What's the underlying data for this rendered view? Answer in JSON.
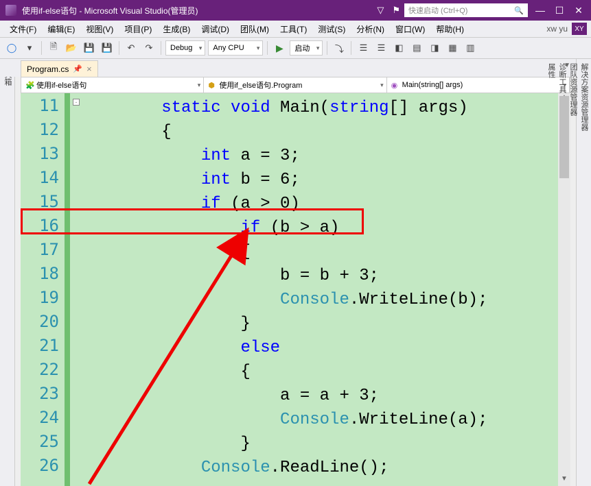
{
  "title": "使用if-else语句 - Microsoft Visual Studio(管理员)",
  "search": {
    "placeholder": "快速启动 (Ctrl+Q)"
  },
  "win": {
    "min": "—",
    "max": "☐",
    "close": "✕"
  },
  "menu": {
    "file": "文件(F)",
    "edit": "编辑(E)",
    "view": "视图(V)",
    "project": "项目(P)",
    "build": "生成(B)",
    "debug": "调试(D)",
    "team": "团队(M)",
    "tools": "工具(T)",
    "test": "测试(S)",
    "analyze": "分析(N)",
    "window": "窗口(W)",
    "help": "帮助(H)",
    "user": "xw yu",
    "xy": "XY"
  },
  "toolbar": {
    "config": "Debug",
    "platform": "Any CPU",
    "run": "启动"
  },
  "lefttool": "工具箱",
  "righttools": [
    "解决方案资源管理器",
    "团队资源管理器",
    "诊断工具",
    "属性"
  ],
  "tab": {
    "name": "Program.cs"
  },
  "nav": {
    "scope": "使用if-else语句",
    "class": "使用if_else语句.Program",
    "method": "Main(string[] args)"
  },
  "lines": {
    "11": "11",
    "12": "12",
    "13": "13",
    "14": "14",
    "15": "15",
    "16": "16",
    "17": "17",
    "18": "18",
    "19": "19",
    "20": "20",
    "21": "21",
    "22": "22",
    "23": "23",
    "24": "24",
    "25": "25",
    "26": "26"
  },
  "code": {
    "l11a": "        ",
    "l11b": "static",
    "l11c": " ",
    "l11d": "void",
    "l11e": " Main(",
    "l11f": "string",
    "l11g": "[] args)",
    "l12": "        {",
    "l13a": "            ",
    "l13b": "int",
    "l13c": " a = 3;",
    "l14a": "            ",
    "l14b": "int",
    "l14c": " b = 6;",
    "l15a": "            ",
    "l15b": "if",
    "l15c": " (a > 0)",
    "l16a": "                ",
    "l16b": "if",
    "l16c": " (b > a)",
    "l17": "                {",
    "l18": "                    b = b + 3;",
    "l19a": "                    ",
    "l19b": "Console",
    "l19c": ".WriteLine(b);",
    "l20": "                }",
    "l21a": "                ",
    "l21b": "else",
    "l22": "                {",
    "l23": "                    a = a + 3;",
    "l24a": "                    ",
    "l24b": "Console",
    "l24c": ".WriteLine(a);",
    "l25": "                }",
    "l26a": "            ",
    "l26b": "Console",
    "l26c": ".ReadLine();"
  }
}
